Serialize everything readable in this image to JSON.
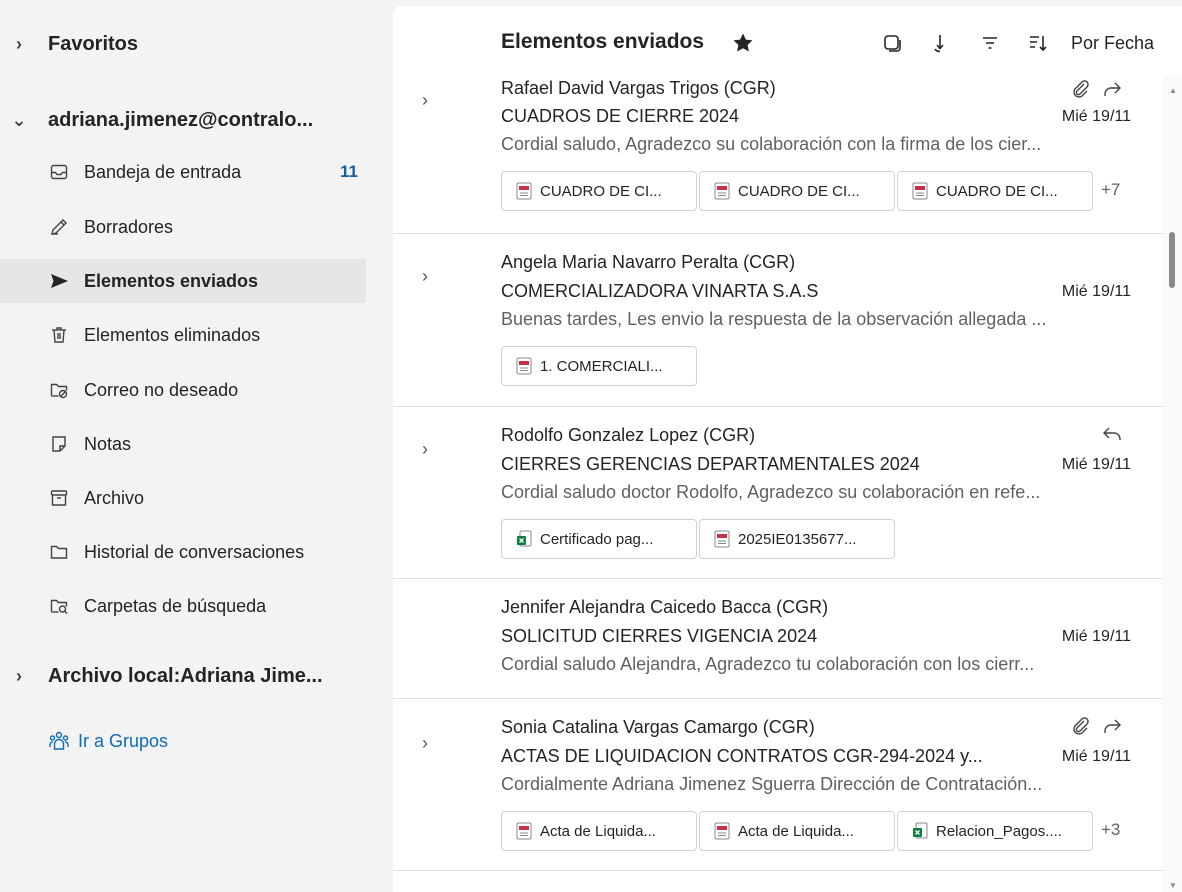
{
  "sidebar": {
    "favorites": "Favoritos",
    "account": "adriana.jimenez@contralo...",
    "folders": [
      {
        "label": "Bandeja de entrada",
        "count": "11"
      },
      {
        "label": "Borradores"
      },
      {
        "label": "Elementos enviados"
      },
      {
        "label": "Elementos eliminados"
      },
      {
        "label": "Correo no deseado"
      },
      {
        "label": "Notas"
      },
      {
        "label": "Archivo"
      },
      {
        "label": "Historial de conversaciones"
      },
      {
        "label": "Carpetas de búsqueda"
      }
    ],
    "local_archive": "Archivo local:Adriana Jime...",
    "groups_link": "Ir a Grupos"
  },
  "header": {
    "title": "Elementos enviados",
    "sort_label": "Por Fecha"
  },
  "messages": [
    {
      "sender": "Rafael David Vargas Trigos (CGR)",
      "subject": "CUADROS DE CIERRE 2024",
      "date": "Mié 19/11",
      "preview": "Cordial saludo, Agradezco su colaboración con la firma de los cier...",
      "attachments": [
        "CUADRO DE CI...",
        "CUADRO DE CI...",
        "CUADRO DE CI..."
      ],
      "more": "+7"
    },
    {
      "sender": "Angela Maria Navarro Peralta (CGR)",
      "subject": "COMERCIALIZADORA VINARTA S.A.S",
      "date": "Mié 19/11",
      "preview": "Buenas tardes, Les envio la respuesta de la observación allegada ...",
      "attachments": [
        "1. COMERCIALI..."
      ]
    },
    {
      "sender": "Rodolfo Gonzalez Lopez (CGR)",
      "subject": "CIERRES GERENCIAS DEPARTAMENTALES 2024",
      "date": "Mié 19/11",
      "preview": "Cordial saludo doctor Rodolfo, Agradezco su colaboración en refe...",
      "attachments": [
        "Certificado pag...",
        "2025IE0135677..."
      ]
    },
    {
      "sender": "Jennifer Alejandra Caicedo Bacca (CGR)",
      "subject": "SOLICITUD CIERRES VIGENCIA 2024",
      "date": "Mié 19/11",
      "preview": "Cordial saludo Alejandra, Agradezco tu colaboración con los cierr..."
    },
    {
      "sender": "Sonia Catalina Vargas Camargo (CGR)",
      "subject": "ACTAS DE LIQUIDACION CONTRATOS CGR-294-2024 y...",
      "date": "Mié 19/11",
      "preview": "Cordialmente Adriana Jimenez Sguerra Dirección de Contratación...",
      "attachments": [
        "Acta de Liquida...",
        "Acta de Liquida...",
        "Relacion_Pagos...."
      ],
      "more": "+3"
    }
  ],
  "colors": {
    "accent": "#0f6cbd",
    "selected_bg": "#e6e6e6",
    "pane_bg": "#f3f3f3",
    "pdf_red": "#c4314b",
    "excel_green": "#107c41"
  }
}
